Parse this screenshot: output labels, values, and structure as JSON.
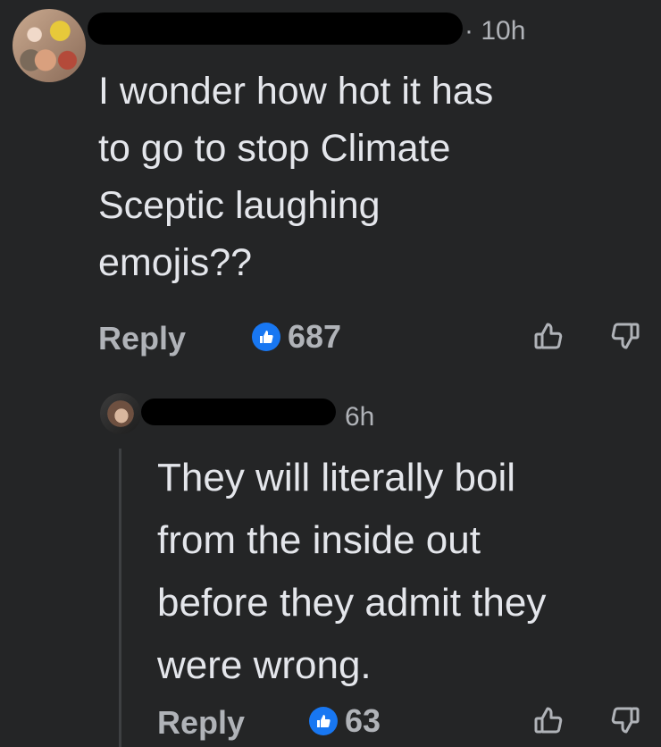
{
  "comment": {
    "timestamp": "· 10h",
    "body_lines": [
      "I wonder how hot it has",
      "to go to stop Climate",
      "Sceptic laughing",
      "emojis??"
    ],
    "reply_label": "Reply",
    "like_count": "687",
    "like_icon": "thumbs-up-badge",
    "upvote_icon": "thumbs-up-outline",
    "downvote_icon": "thumbs-down-outline"
  },
  "reply": {
    "timestamp": "6h",
    "body_lines": [
      "They will literally boil",
      "from the inside out",
      "before they admit they",
      "were wrong."
    ],
    "reply_label": "Reply",
    "like_count": "63",
    "like_icon": "thumbs-up-badge",
    "upvote_icon": "thumbs-up-outline",
    "downvote_icon": "thumbs-down-outline"
  },
  "colors": {
    "background": "#242526",
    "primary_text": "#e4e6eb",
    "secondary_text": "#b0b3b8",
    "like_badge": "#1877f2"
  }
}
